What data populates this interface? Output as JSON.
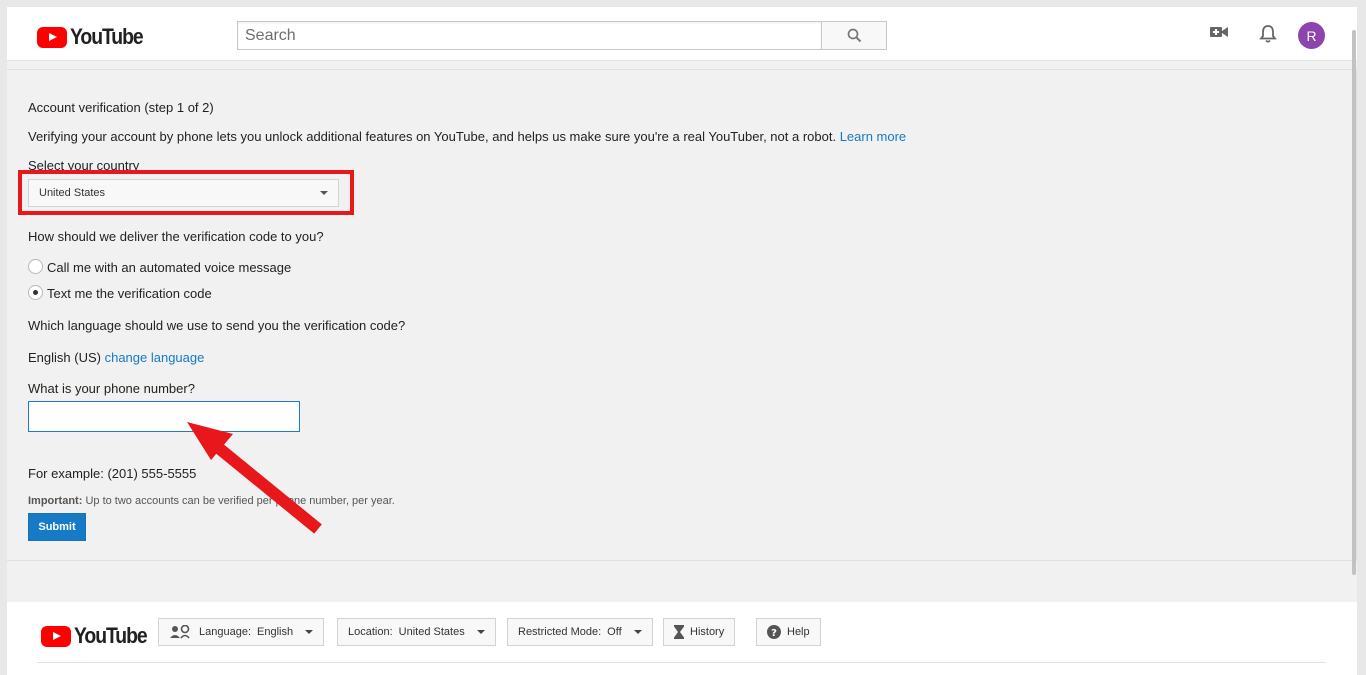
{
  "header": {
    "logo_text": "YouTube",
    "search_placeholder": "Search",
    "avatar_letter": "R"
  },
  "form": {
    "title": "Account verification (step 1 of 2)",
    "intro": "Verifying your account by phone lets you unlock additional features on YouTube, and helps us make sure you're a real YouTuber, not a robot.",
    "learn_more": "Learn more",
    "country_label": "Select your country",
    "country_value": "United States",
    "delivery_label": "How should we deliver the verification code to you?",
    "delivery_options": [
      {
        "label": "Call me with an automated voice message",
        "checked": false
      },
      {
        "label": "Text me the verification code",
        "checked": true
      }
    ],
    "language_label": "Which language should we use to send you the verification code?",
    "language_value": "English (US)",
    "change_language": "change language",
    "phone_label": "What is your phone number?",
    "phone_value": "",
    "example": "For example: (201) 555-5555",
    "important_label": "Important:",
    "important_text": "Up to two accounts can be verified per phone number, per year.",
    "submit_label": "Submit"
  },
  "annotations": {
    "highlight_color": "#e8171c",
    "arrow_color": "#e8171c"
  },
  "footer": {
    "logo_text": "YouTube",
    "language_prefix": "Language:",
    "language_value": "English",
    "location_prefix": "Location:",
    "location_value": "United States",
    "restricted_prefix": "Restricted Mode:",
    "restricted_value": "Off",
    "history_label": "History",
    "help_label": "Help"
  },
  "colors": {
    "brand_red": "#ff0000",
    "link_blue": "#167ac6",
    "avatar_purple": "#8e44ad"
  }
}
